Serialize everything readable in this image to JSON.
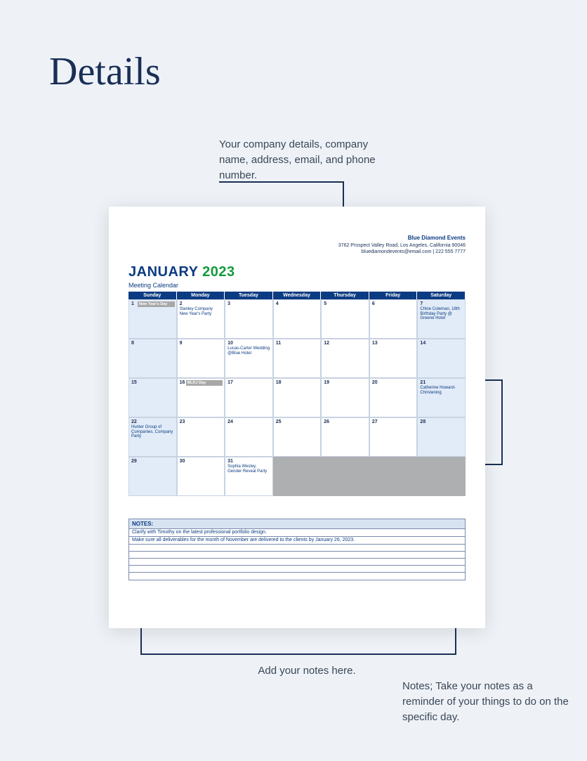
{
  "page": {
    "title": "Details"
  },
  "callouts": {
    "top": "Your company details, company name, address, email, and phone number.",
    "mid": "Notes; Take your notes as a reminder of your things to do on the specific day.",
    "bot": "Add your notes here."
  },
  "company": {
    "name": "Blue Diamond Events",
    "address": "3762 Prospect Valley Road, Los Angeles, California 90046",
    "contact": "bluediamondevents@email.com | 222 555 7777"
  },
  "calendar": {
    "month": "JANUARY",
    "year": "2023",
    "subtitle": "Meeting Calendar",
    "days": [
      "Sunday",
      "Monday",
      "Tuesday",
      "Wednesday",
      "Thursday",
      "Friday",
      "Saturday"
    ],
    "weeks": [
      [
        {
          "n": "1",
          "weekend": true,
          "label": "New Year's Day",
          "evt": ""
        },
        {
          "n": "2",
          "evt": "Stanley Company New Year's Party"
        },
        {
          "n": "3",
          "evt": ""
        },
        {
          "n": "4",
          "evt": ""
        },
        {
          "n": "5",
          "evt": ""
        },
        {
          "n": "6",
          "evt": ""
        },
        {
          "n": "7",
          "weekend": true,
          "evt": "Chloe Coleman, 18th Birthday Party @ Greene Hotel"
        }
      ],
      [
        {
          "n": "8",
          "weekend": true,
          "evt": ""
        },
        {
          "n": "9",
          "evt": ""
        },
        {
          "n": "10",
          "evt": "Lucas-Carter Wedding @Blue Hotel"
        },
        {
          "n": "11",
          "evt": ""
        },
        {
          "n": "12",
          "evt": ""
        },
        {
          "n": "13",
          "evt": ""
        },
        {
          "n": "14",
          "weekend": true,
          "evt": ""
        }
      ],
      [
        {
          "n": "15",
          "weekend": true,
          "evt": ""
        },
        {
          "n": "16",
          "label": "MLKJ Day",
          "evt": ""
        },
        {
          "n": "17",
          "evt": ""
        },
        {
          "n": "18",
          "evt": ""
        },
        {
          "n": "19",
          "evt": ""
        },
        {
          "n": "20",
          "evt": ""
        },
        {
          "n": "21",
          "weekend": true,
          "evt": "Catherine Howard- Christening"
        }
      ],
      [
        {
          "n": "22",
          "weekend": true,
          "evt": "Hunter Group of Companies, Company Party"
        },
        {
          "n": "23",
          "evt": ""
        },
        {
          "n": "24",
          "evt": ""
        },
        {
          "n": "25",
          "evt": ""
        },
        {
          "n": "26",
          "evt": ""
        },
        {
          "n": "27",
          "evt": ""
        },
        {
          "n": "28",
          "weekend": true,
          "evt": ""
        }
      ],
      [
        {
          "n": "29",
          "weekend": true,
          "evt": ""
        },
        {
          "n": "30",
          "evt": ""
        },
        {
          "n": "31",
          "evt": "Sophia Wesley, Gender Reveal Party"
        },
        {
          "n": "",
          "empty": true,
          "evt": ""
        },
        {
          "n": "",
          "empty": true,
          "evt": ""
        },
        {
          "n": "",
          "empty": true,
          "evt": ""
        },
        {
          "n": "",
          "empty": true,
          "evt": ""
        }
      ]
    ]
  },
  "notes": {
    "header": "NOTES:",
    "lines": [
      "Clarify with Timothy on the latest professional portfolio design.",
      "Make sure all deliverables for the month of November are delivered to the clients by January 26, 2023.",
      "",
      "",
      "",
      "",
      ""
    ]
  }
}
